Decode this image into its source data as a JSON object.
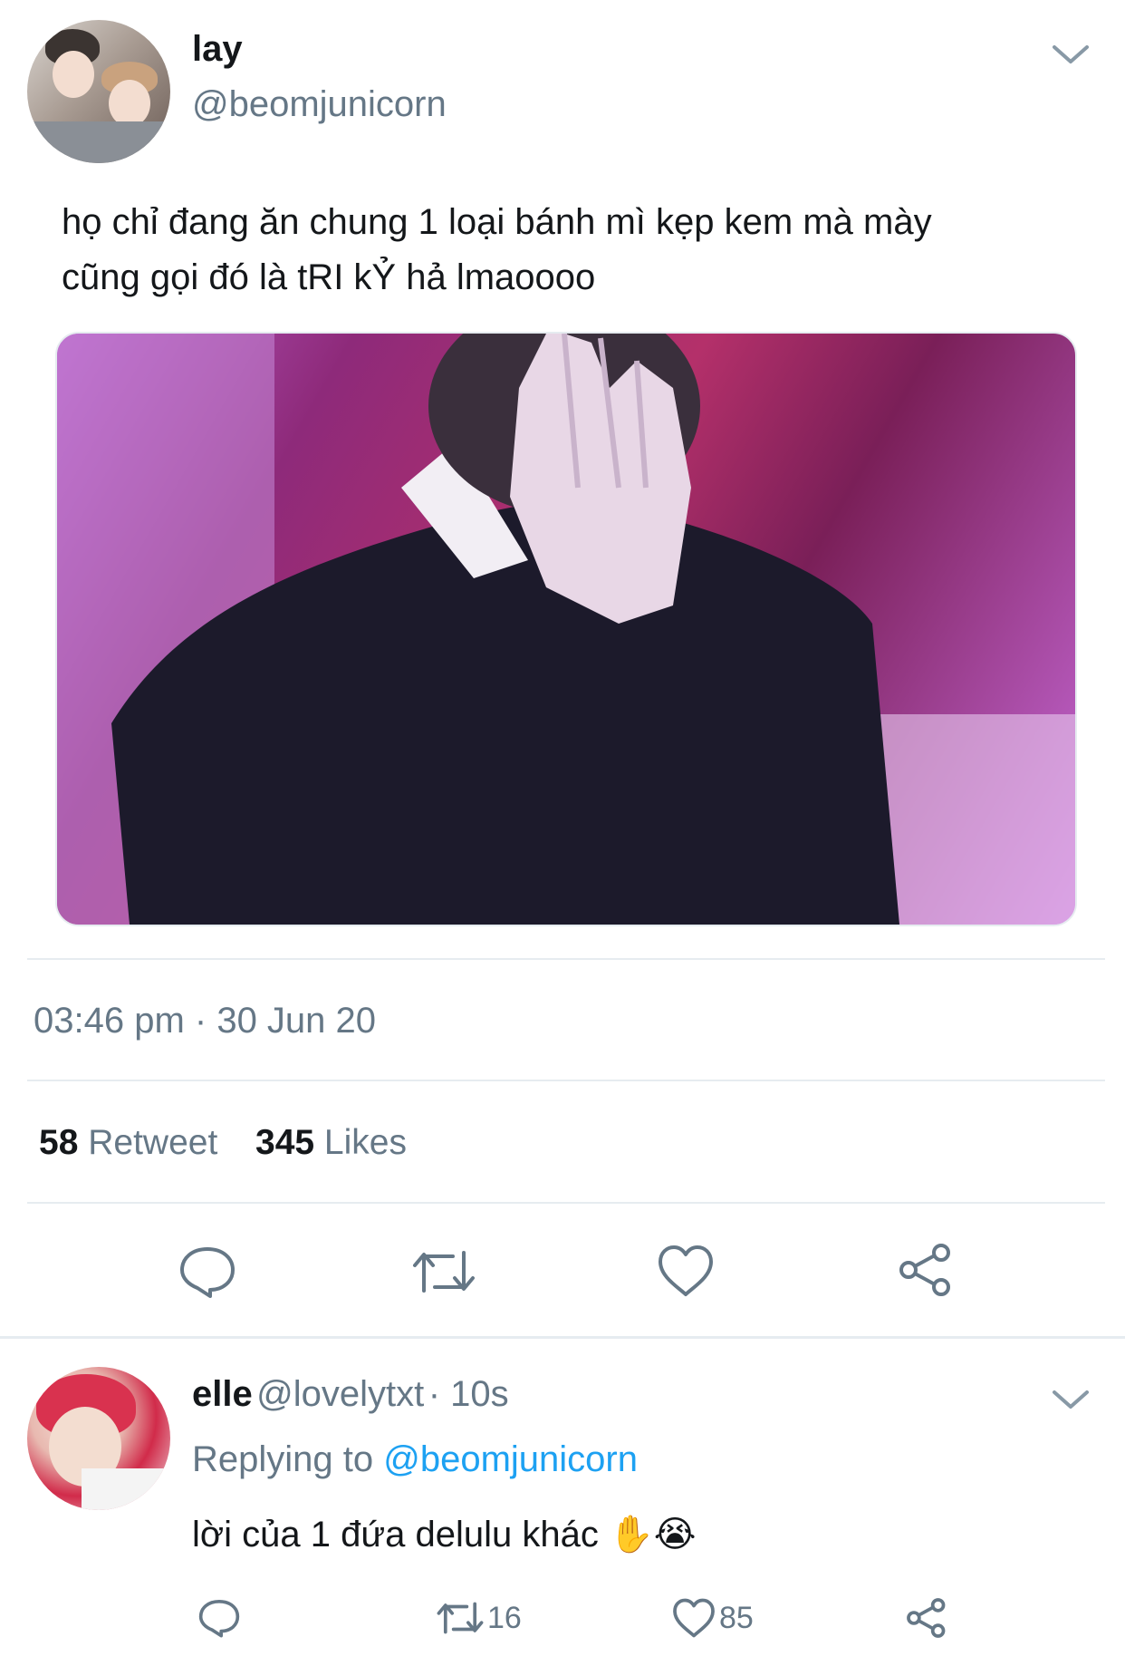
{
  "tweet": {
    "display_name": "lay",
    "handle": "@beomjunicorn",
    "text_line1": "họ chỉ đang ăn chung 1 loại bánh mì kẹp kem mà mày",
    "text_line2": "cũng gọi đó là tRI kỶ hả lmaoooo",
    "timestamp": "03:46 pm · 30 Jun 20",
    "retweets_count": "58",
    "retweets_label": "Retweet",
    "likes_count": "345",
    "likes_label": "Likes"
  },
  "reply": {
    "display_name": "elle",
    "handle": "@lovelytxt",
    "time": "· 10s",
    "replying_prefix": "Replying to",
    "replying_to": "@beomjunicorn",
    "text": "lời của 1 đứa delulu khác",
    "emoji": "✋😭",
    "retweet_count": "16",
    "like_count": "85"
  },
  "icons": [
    "chevron-down-icon",
    "reply-icon",
    "retweet-icon",
    "like-icon",
    "share-icon"
  ],
  "colors": {
    "text": "#14171a",
    "secondary": "#657786",
    "accent": "#1da1f2",
    "divider": "#e6ecf0"
  }
}
